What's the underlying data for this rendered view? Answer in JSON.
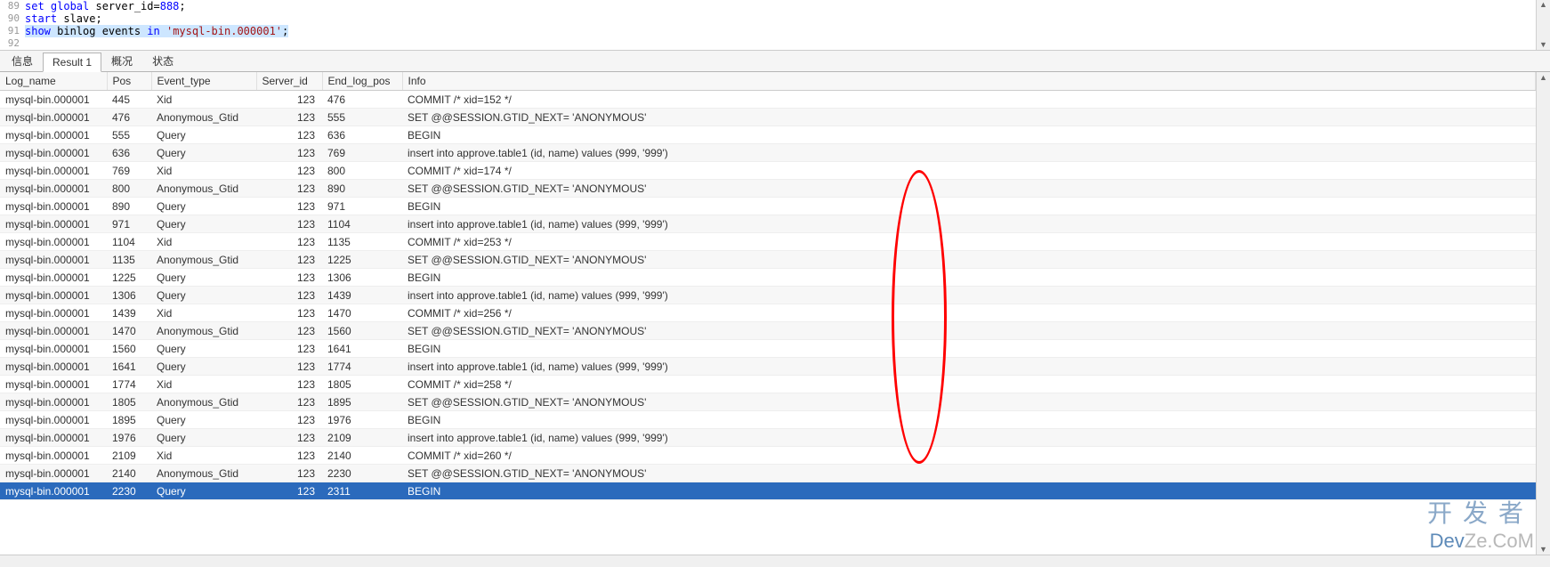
{
  "editor": {
    "lines": [
      {
        "num": "89",
        "html": "<span class='kw-blue'>set global</span><span class='kw-black'> server_id=</span><span class='kw-blue'>888</span><span class='kw-black'>;</span>"
      },
      {
        "num": "90",
        "html": "<span class='kw-blue'>start</span><span class='kw-black'> slave;</span>"
      },
      {
        "num": "91",
        "html": "<span class='sel'><span class='kw-blue'>show</span><span class='kw-black'> binlog events </span><span class='kw-blue'>in</span><span class='kw-black'> </span><span class='kw-purple'>'mysql-bin.000001'</span><span class='kw-black'>;</span></span>"
      },
      {
        "num": "92",
        "html": ""
      }
    ]
  },
  "tabs": [
    {
      "label": "信息",
      "active": false
    },
    {
      "label": "Result 1",
      "active": true
    },
    {
      "label": "概况",
      "active": false
    },
    {
      "label": "状态",
      "active": false
    }
  ],
  "grid": {
    "headers": [
      "Log_name",
      "Pos",
      "Event_type",
      "Server_id",
      "End_log_pos",
      "Info"
    ],
    "rows": [
      {
        "log": "mysql-bin.000001",
        "pos": "445",
        "event": "Xid",
        "sid": "123",
        "end": "476",
        "info": "COMMIT /* xid=152 */"
      },
      {
        "log": "mysql-bin.000001",
        "pos": "476",
        "event": "Anonymous_Gtid",
        "sid": "123",
        "end": "555",
        "info": "SET @@SESSION.GTID_NEXT= 'ANONYMOUS'"
      },
      {
        "log": "mysql-bin.000001",
        "pos": "555",
        "event": "Query",
        "sid": "123",
        "end": "636",
        "info": "BEGIN"
      },
      {
        "log": "mysql-bin.000001",
        "pos": "636",
        "event": "Query",
        "sid": "123",
        "end": "769",
        "info": "insert into approve.table1 (id, name) values (999, '999')"
      },
      {
        "log": "mysql-bin.000001",
        "pos": "769",
        "event": "Xid",
        "sid": "123",
        "end": "800",
        "info": "COMMIT /* xid=174 */"
      },
      {
        "log": "mysql-bin.000001",
        "pos": "800",
        "event": "Anonymous_Gtid",
        "sid": "123",
        "end": "890",
        "info": "SET @@SESSION.GTID_NEXT= 'ANONYMOUS'"
      },
      {
        "log": "mysql-bin.000001",
        "pos": "890",
        "event": "Query",
        "sid": "123",
        "end": "971",
        "info": "BEGIN"
      },
      {
        "log": "mysql-bin.000001",
        "pos": "971",
        "event": "Query",
        "sid": "123",
        "end": "1104",
        "info": "insert into approve.table1 (id, name) values (999, '999')"
      },
      {
        "log": "mysql-bin.000001",
        "pos": "1104",
        "event": "Xid",
        "sid": "123",
        "end": "1135",
        "info": "COMMIT /* xid=253 */"
      },
      {
        "log": "mysql-bin.000001",
        "pos": "1135",
        "event": "Anonymous_Gtid",
        "sid": "123",
        "end": "1225",
        "info": "SET @@SESSION.GTID_NEXT= 'ANONYMOUS'"
      },
      {
        "log": "mysql-bin.000001",
        "pos": "1225",
        "event": "Query",
        "sid": "123",
        "end": "1306",
        "info": "BEGIN"
      },
      {
        "log": "mysql-bin.000001",
        "pos": "1306",
        "event": "Query",
        "sid": "123",
        "end": "1439",
        "info": "insert into approve.table1 (id, name) values (999, '999')"
      },
      {
        "log": "mysql-bin.000001",
        "pos": "1439",
        "event": "Xid",
        "sid": "123",
        "end": "1470",
        "info": "COMMIT /* xid=256 */"
      },
      {
        "log": "mysql-bin.000001",
        "pos": "1470",
        "event": "Anonymous_Gtid",
        "sid": "123",
        "end": "1560",
        "info": "SET @@SESSION.GTID_NEXT= 'ANONYMOUS'"
      },
      {
        "log": "mysql-bin.000001",
        "pos": "1560",
        "event": "Query",
        "sid": "123",
        "end": "1641",
        "info": "BEGIN"
      },
      {
        "log": "mysql-bin.000001",
        "pos": "1641",
        "event": "Query",
        "sid": "123",
        "end": "1774",
        "info": "insert into approve.table1 (id, name) values (999, '999')"
      },
      {
        "log": "mysql-bin.000001",
        "pos": "1774",
        "event": "Xid",
        "sid": "123",
        "end": "1805",
        "info": "COMMIT /* xid=258 */"
      },
      {
        "log": "mysql-bin.000001",
        "pos": "1805",
        "event": "Anonymous_Gtid",
        "sid": "123",
        "end": "1895",
        "info": "SET @@SESSION.GTID_NEXT= 'ANONYMOUS'"
      },
      {
        "log": "mysql-bin.000001",
        "pos": "1895",
        "event": "Query",
        "sid": "123",
        "end": "1976",
        "info": "BEGIN"
      },
      {
        "log": "mysql-bin.000001",
        "pos": "1976",
        "event": "Query",
        "sid": "123",
        "end": "2109",
        "info": "insert into approve.table1 (id, name) values (999, '999')"
      },
      {
        "log": "mysql-bin.000001",
        "pos": "2109",
        "event": "Xid",
        "sid": "123",
        "end": "2140",
        "info": "COMMIT /* xid=260 */"
      },
      {
        "log": "mysql-bin.000001",
        "pos": "2140",
        "event": "Anonymous_Gtid",
        "sid": "123",
        "end": "2230",
        "info": "SET @@SESSION.GTID_NEXT= 'ANONYMOUS'"
      },
      {
        "log": "mysql-bin.000001",
        "pos": "2230",
        "event": "Query",
        "sid": "123",
        "end": "2311",
        "info": "BEGIN",
        "selected": true
      }
    ]
  },
  "watermark": {
    "cn": "开发者",
    "en1": "Dev",
    "en2": "Ze.CoM"
  }
}
